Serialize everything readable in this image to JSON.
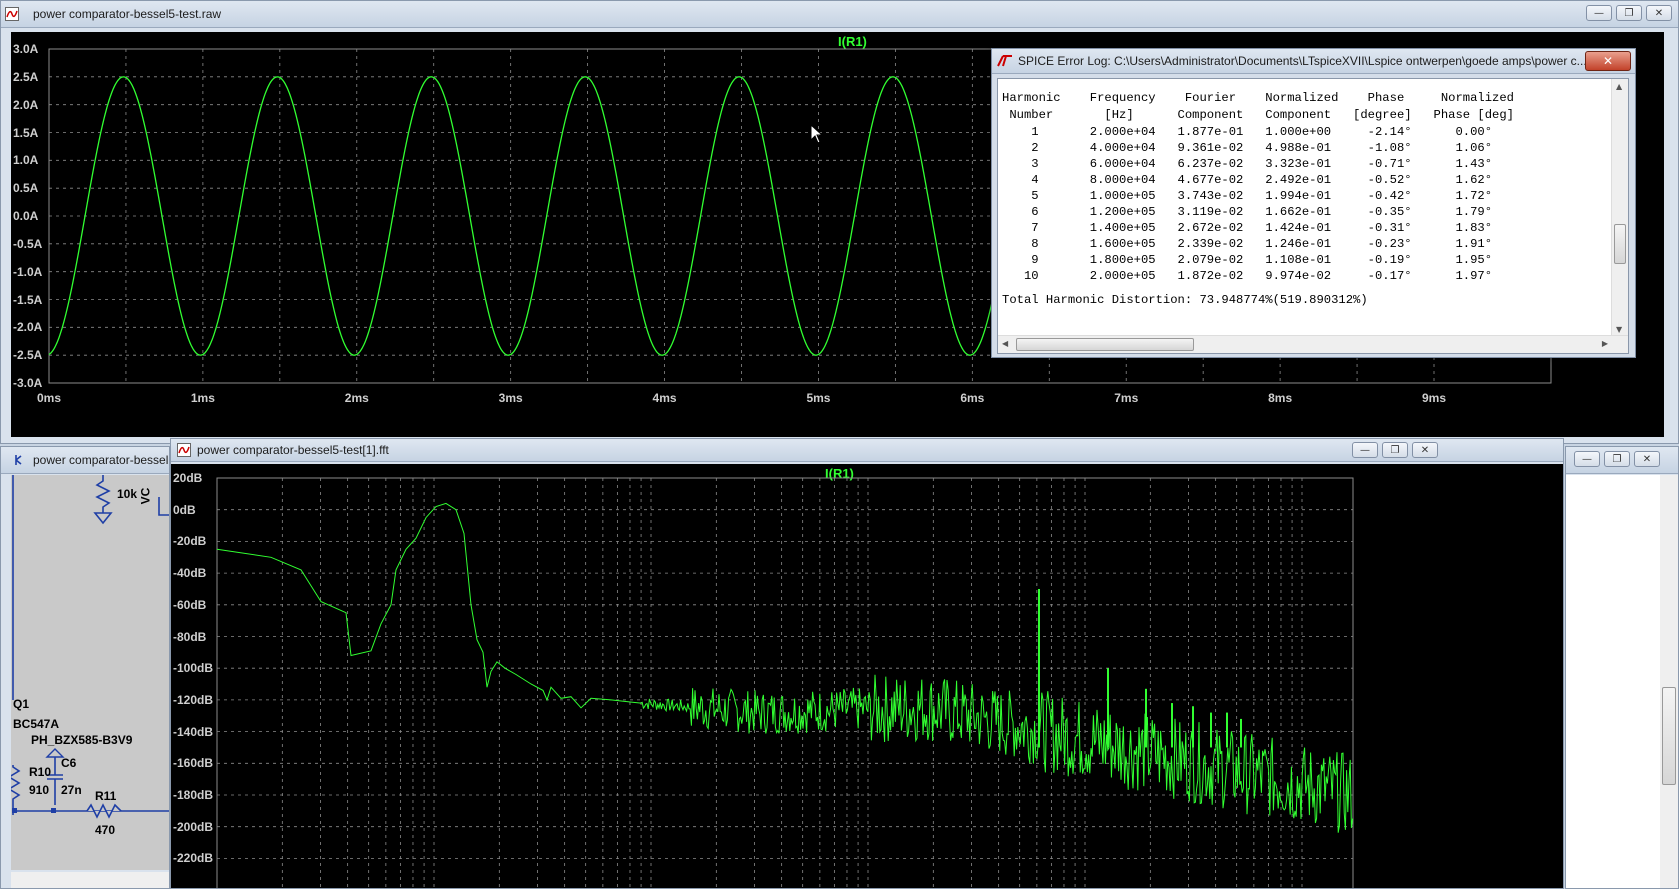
{
  "top_window": {
    "title": "power comparator-bessel5-test.raw",
    "trace_label": "I(R1)",
    "y_ticks": [
      "3.0A",
      "2.5A",
      "2.0A",
      "1.5A",
      "1.0A",
      "0.5A",
      "0.0A",
      "-0.5A",
      "-1.0A",
      "-1.5A",
      "-2.0A",
      "-2.5A",
      "-3.0A"
    ],
    "x_ticks": [
      "0ms",
      "1ms",
      "2ms",
      "3ms",
      "4ms",
      "5ms",
      "6ms",
      "7ms",
      "8ms",
      "9ms"
    ]
  },
  "error_log": {
    "title": "SPICE Error Log: C:\\Users\\Administrator\\Documents\\LTspiceXVII\\Lspice ontwerpen\\goede amps\\power c...",
    "close_label": "✕",
    "header1": "Harmonic    Frequency    Fourier    Normalized    Phase     Normalized",
    "header2": " Number       [Hz]      Component   Component   [degree]   Phase [deg]",
    "rows": [
      "    1       2.000e+04   1.877e-01   1.000e+00     -2.14°      0.00°",
      "    2       4.000e+04   9.361e-02   4.988e-01     -1.08°      1.06°",
      "    3       6.000e+04   6.237e-02   3.323e-01     -0.71°      1.43°",
      "    4       8.000e+04   4.677e-02   2.492e-01     -0.52°      1.62°",
      "    5       1.000e+05   3.743e-02   1.994e-01     -0.42°      1.72°",
      "    6       1.200e+05   3.119e-02   1.662e-01     -0.35°      1.79°",
      "    7       1.400e+05   2.672e-02   1.424e-01     -0.31°      1.83°",
      "    8       1.600e+05   2.339e-02   1.246e-01     -0.23°      1.91°",
      "    9       1.800e+05   2.079e-02   1.108e-01     -0.19°      1.95°",
      "   10       2.000e+05   1.872e-02   9.974e-02     -0.17°      1.97°"
    ],
    "thd": "Total Harmonic Distortion: 73.948774%(519.890312%)"
  },
  "schematic_window": {
    "title": "power comparator-bessel",
    "labels": {
      "r_val": "10k",
      "vc": "VC",
      "q1": "Q1",
      "q1_part": "BC547A",
      "zener": "PH_BZX585-B3V9",
      "r10": "R10",
      "c6": "C6",
      "r10_val": "910",
      "c6_val": "27n",
      "r11": "R11",
      "r11_val": "470"
    }
  },
  "fft_window": {
    "title": "power comparator-bessel5-test[1].fft",
    "trace_label": "I(R1)",
    "y_ticks": [
      "20dB",
      "0dB",
      "-20dB",
      "-40dB",
      "-60dB",
      "-80dB",
      "-100dB",
      "-120dB",
      "-140dB",
      "-160dB",
      "-180dB",
      "-200dB",
      "-220dB"
    ]
  },
  "window_buttons": {
    "minimize": "—",
    "restore": "❐",
    "close": "✕"
  },
  "colors": {
    "trace": "#31ff31",
    "grid": "#8c8c8c",
    "plot_bg": "#000000",
    "schematic_wire": "#1f3fa6"
  }
}
